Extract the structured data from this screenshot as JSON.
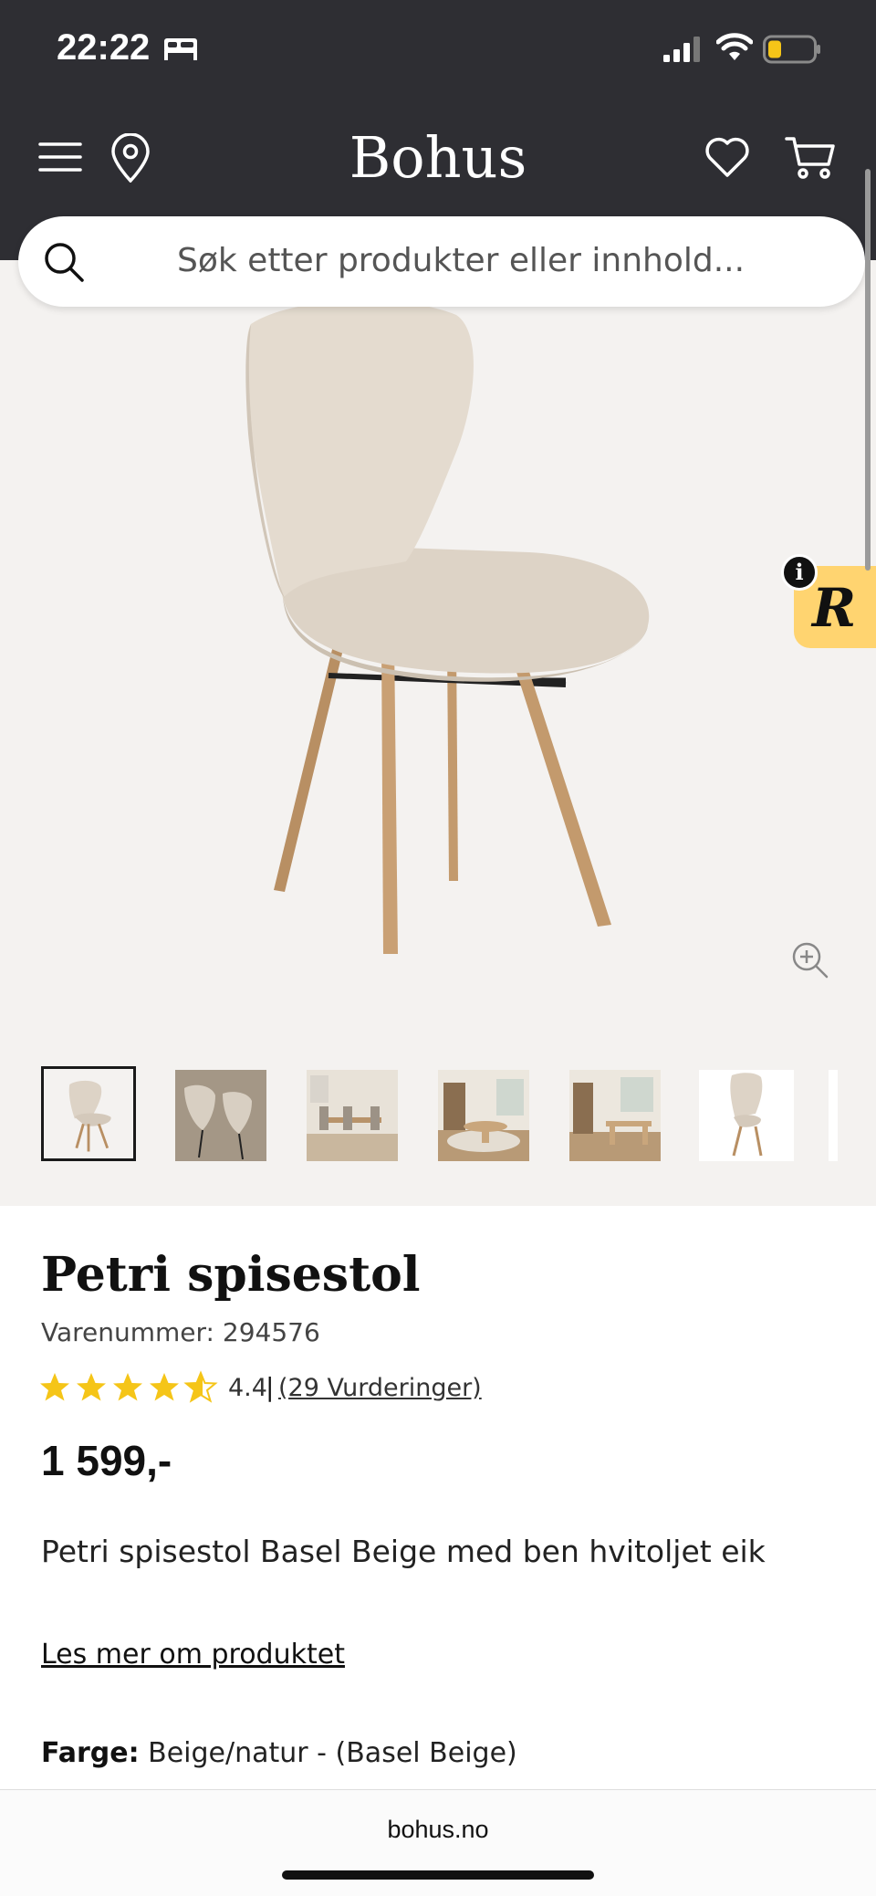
{
  "status_bar": {
    "time": "22:22",
    "icons": [
      "bed-icon",
      "signal-icon",
      "wifi-icon",
      "battery-icon"
    ]
  },
  "header": {
    "logo": "Bohus",
    "icons": [
      "menu-icon",
      "location-icon",
      "heart-icon",
      "cart-icon"
    ],
    "background": "#2e2e33"
  },
  "search": {
    "placeholder": "Søk etter produkter eller innhold..."
  },
  "gallery": {
    "thumbnail_count": 7,
    "selected_index": 0
  },
  "badge": {
    "info": "i",
    "letter": "R",
    "color": "#ffd470"
  },
  "product": {
    "title": "Petri spisestol",
    "sku": "Varenummer: 294576",
    "rating": 4.4,
    "rating_text": "4.4",
    "rating_separator": "|",
    "rating_count": "(29 Vurderinger)",
    "star_color": "#f5c518",
    "price": "1 599,-",
    "description": "Petri spisestol Basel Beige med ben hvitoljet eik",
    "read_more": "Les mer om produktet",
    "color_label": "Farge:",
    "color_value": "Beige/natur - (Basel Beige)"
  },
  "browser": {
    "url": "bohus.no"
  }
}
